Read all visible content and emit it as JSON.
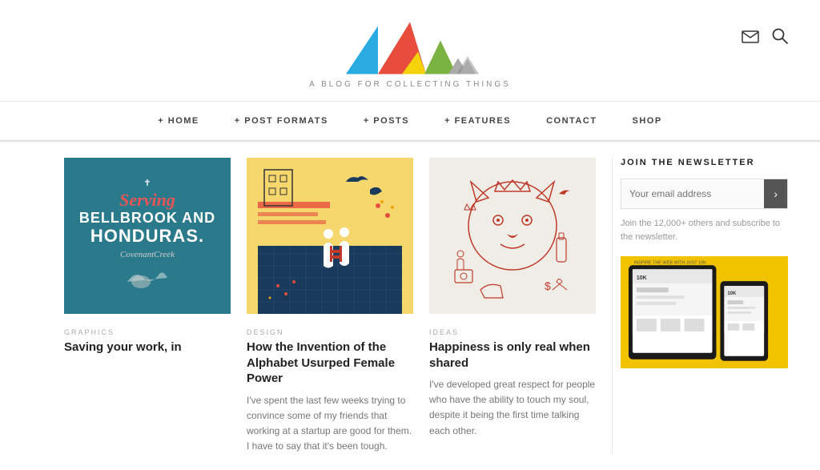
{
  "header": {
    "tagline": "A BLOG FOR COLLECTING THINGS",
    "icons": {
      "email": "✉",
      "search": "🔍"
    }
  },
  "nav": {
    "items": [
      {
        "label": "+ HOME",
        "id": "home"
      },
      {
        "label": "+ POST FORMATS",
        "id": "post-formats"
      },
      {
        "label": "+ POSTS",
        "id": "posts"
      },
      {
        "label": "+ FEATURES",
        "id": "features"
      },
      {
        "label": "CONTACT",
        "id": "contact"
      },
      {
        "label": "SHOP",
        "id": "shop"
      }
    ]
  },
  "posts": [
    {
      "id": "post-1",
      "category": "GRAPHICS",
      "title": "Saving your work, in",
      "excerpt": "",
      "image_type": "serving",
      "image_text": {
        "serving": "Serving",
        "line1": "BELLBROOK AND",
        "line2": "HONDURAS.",
        "line3": "CovenantCreek"
      }
    },
    {
      "id": "post-2",
      "category": "DESIGN",
      "title": "How the Invention of the Alphabet Usurped Female Power",
      "excerpt": "I've spent the last few weeks trying to convince some of my friends that working at a startup are good for them. I have to say that it's been tough.",
      "image_type": "design"
    },
    {
      "id": "post-3",
      "category": "IDEAS",
      "title": "Happiness is only real when shared",
      "excerpt": "I've developed great respect for people who have the ability to touch my soul, despite it being the first time talking each other.",
      "image_type": "ideas"
    }
  ],
  "sidebar": {
    "newsletter": {
      "title": "JOIN THE NEWSLETTER",
      "input_placeholder": "Your email address",
      "submit_arrow": "›",
      "description": "Join the 12,000+ others and subscribe to the newsletter."
    }
  }
}
